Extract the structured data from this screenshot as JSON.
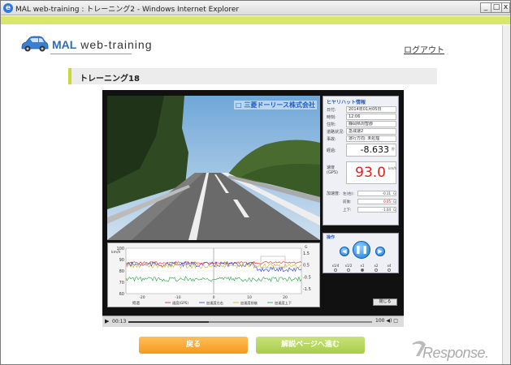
{
  "window": {
    "title": "MAL web-training : トレーニング2 - Windows Internet Explorer",
    "min": "_",
    "max": "□",
    "close": "x"
  },
  "brand": {
    "logo_prefix": "MAL",
    "logo_suffix": " web-training"
  },
  "header": {
    "logout_label": "ログアウト"
  },
  "page": {
    "heading": "トレーニング18"
  },
  "video": {
    "caption": "□ 三菱ドーリース株式会社"
  },
  "info": {
    "heading": "ヒヤリハット情報",
    "rows": [
      {
        "label": "日付:",
        "value": "2014年01月05日"
      },
      {
        "label": "時刻:",
        "value": "12:06"
      },
      {
        "label": "住所:",
        "value": "静岡県周智郡"
      },
      {
        "label": "道路状況:",
        "value": "急減速2"
      },
      {
        "label": "事故:",
        "value": "運行方向: 未処理"
      }
    ],
    "distance_label": "経過:",
    "distance_value": "-8.633",
    "distance_unit": "秒",
    "speed_label": "速度",
    "speed_sublabel": "(GPS)",
    "speed_value": "93.0",
    "speed_unit": "km/h",
    "accel_label": "加速度:",
    "accel": [
      {
        "label": "左(右):",
        "value": "-0.11",
        "unit": "G"
      },
      {
        "label": "前後:",
        "value": "0.05",
        "unit": "G"
      },
      {
        "label": "上下:",
        "value": "-1.04",
        "unit": "G"
      }
    ]
  },
  "control": {
    "heading": "操作",
    "speeds": [
      "x1/4",
      "x1/2",
      "x1",
      "x2",
      "x4"
    ],
    "selected_speed": "x1",
    "close_label": "閉じる"
  },
  "chart_data": {
    "type": "line",
    "ylabel_left": "km/h",
    "ylabel_right": "G",
    "left_ticks": [
      "100",
      "90",
      "80",
      "70",
      "60"
    ],
    "right_ticks": [
      "1.5",
      "0.5",
      "-0.5",
      "-1.5"
    ],
    "x_ticks": [
      "-20",
      "-10",
      "0",
      "10",
      "20"
    ],
    "xlabel": "経過",
    "legend": [
      {
        "name": "速度(GPS)",
        "color": "#e02020"
      },
      {
        "name": "加速度左右",
        "color": "#2040d0"
      },
      {
        "name": "加速度前後",
        "color": "#d0b020"
      },
      {
        "name": "加速度上下",
        "color": "#20a040"
      }
    ],
    "series_colors": [
      "#e02020",
      "#2040d0",
      "#d0b020",
      "#20a040"
    ]
  },
  "media": {
    "play_icon": "▶",
    "time": "00:13",
    "volume": "100 ◀) □",
    "progress": 0.33
  },
  "buttons": {
    "back_label": "戻る",
    "next_label": "解説ページへ進む"
  },
  "watermark": {
    "text": "Response."
  }
}
